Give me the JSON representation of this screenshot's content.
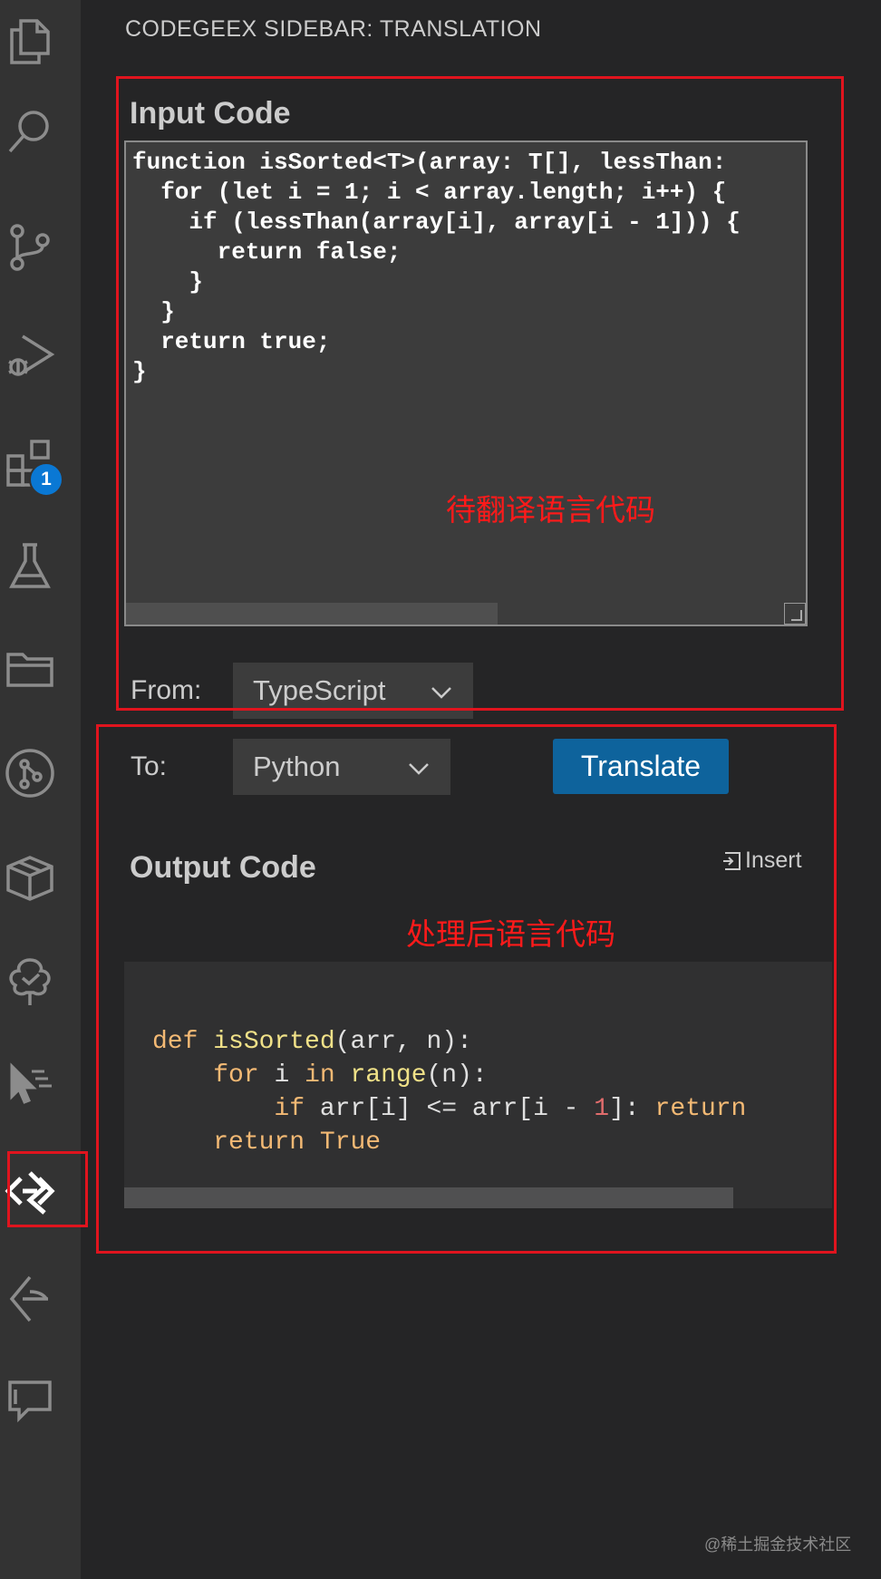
{
  "sidebar": {
    "title": "CODEGEEX SIDEBAR: TRANSLATION",
    "input_heading": "Input Code",
    "input_code": "function isSorted<T>(array: T[], lessThan:\n  for (let i = 1; i < array.length; i++) {\n    if (lessThan(array[i], array[i - 1])) {\n      return false;\n    }\n  }\n  return true;\n}",
    "from_label": "From:",
    "from_value": "TypeScript",
    "to_label": "To:",
    "to_value": "Python",
    "translate_label": "Translate",
    "output_heading": "Output Code",
    "insert_label": "Insert",
    "output_code": {
      "line1": [
        "def",
        "isSorted",
        "(arr, n):"
      ],
      "line2": [
        "for",
        " i ",
        "in",
        "range",
        "(n):"
      ],
      "line3": [
        "if",
        " arr[i] <= arr[i - ",
        "1",
        "]: ",
        "return"
      ],
      "line4": [
        "return",
        "True"
      ]
    }
  },
  "activity": {
    "icons": [
      "explorer-icon",
      "search-icon",
      "source-control-icon",
      "run-debug-icon",
      "extensions-icon",
      "testing-icon",
      "folder-icon",
      "git-graph-icon",
      "package-icon",
      "tree-icon",
      "cursor-icon",
      "codegeex-icon",
      "lens-icon",
      "chat-icon"
    ],
    "extensions_badge": "1"
  },
  "annotations": {
    "input_note": "待翻译语言代码",
    "output_note": "处理后语言代码"
  },
  "watermark": "@稀土掘金技术社区",
  "colors": {
    "accent_button": "#0e639c",
    "annotation_red": "#e0141e",
    "badge_blue": "#0a78d4"
  }
}
